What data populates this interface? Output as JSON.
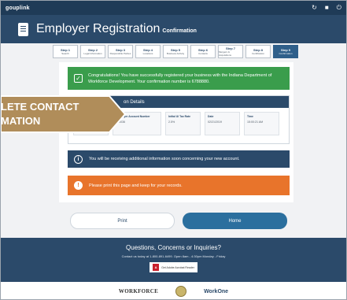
{
  "app": {
    "logo": "gouplink"
  },
  "header": {
    "title": "Employer Registration",
    "subtitle": "Confirmation"
  },
  "icons": {
    "refresh": "refresh-icon",
    "briefcase": "briefcase-icon",
    "power": "power-icon"
  },
  "steps": [
    {
      "num": "Step 1",
      "label": "Search"
    },
    {
      "num": "Step 2",
      "label": "Legal Information"
    },
    {
      "num": "Step 3",
      "label": "Responsible Parties"
    },
    {
      "num": "Step 4",
      "label": "Locations"
    },
    {
      "num": "Step 5",
      "label": "Business Activity"
    },
    {
      "num": "Step 6",
      "label": "Contacts"
    },
    {
      "num": "Step 7",
      "label": "Mergers & Acquisitions"
    },
    {
      "num": "Step 8",
      "label": "Certification"
    },
    {
      "num": "Step 9",
      "label": "Confirmation"
    }
  ],
  "success": {
    "text": "Congratulations! You have successfully registered your business with the Indiana Department of Workforce Development. Your confirmation number is 6788880."
  },
  "details": {
    "heading": "on Details",
    "cards": [
      {
        "label": "Employer Account Number",
        "value": "000036"
      },
      {
        "label": "Initial UI Tax Rate",
        "value": "2.5%"
      },
      {
        "label": "Date",
        "value": "02/21/2019"
      },
      {
        "label": "Time",
        "value": "15:00:21 AM"
      }
    ]
  },
  "callout": {
    "line1": "LETE CONTACT",
    "line2": "MATION"
  },
  "info": {
    "text": "You will be receiving additional information soon concerning your new account."
  },
  "warning": {
    "text": "Please print this page and keep for your records."
  },
  "buttons": {
    "print": "Print",
    "home": "Home"
  },
  "footer": {
    "title": "Questions, Concerns or Inquiries?",
    "contact": "Contact us today at 1-800-891-6499. Open 8am - 4:30pm Monday - Friday",
    "pdf_label": "Get Adobe Acrobat Reader"
  },
  "partner_logos": {
    "dwd": "WORKFORCE",
    "workone": "WorkOne"
  },
  "colors": {
    "navy": "#2b4a6a",
    "green": "#3a9d4c",
    "orange": "#e8742b",
    "home_button": "#2b6f9e",
    "callout": "#b08d5a"
  }
}
